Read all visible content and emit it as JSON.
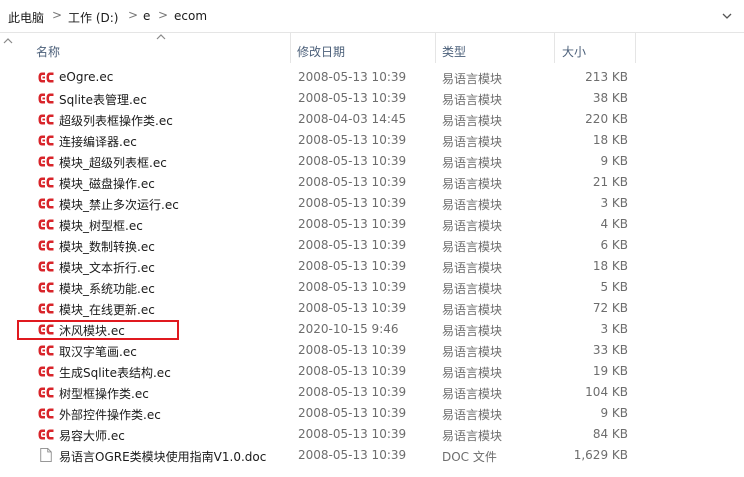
{
  "breadcrumb": {
    "items": [
      "此电脑",
      "工作 (D:)",
      "e",
      "ecom"
    ],
    "separator": ">"
  },
  "columns": {
    "name": "名称",
    "date": "修改日期",
    "type": "类型",
    "size": "大小"
  },
  "files": [
    {
      "name": "eOgre.ec",
      "date": "2008-05-13 10:39",
      "type": "易语言模块",
      "size": "213 KB",
      "icon": "ec-module-icon"
    },
    {
      "name": "Sqlite表管理.ec",
      "date": "2008-05-13 10:39",
      "type": "易语言模块",
      "size": "38 KB",
      "icon": "ec-module-icon"
    },
    {
      "name": "超级列表框操作类.ec",
      "date": "2008-04-03 14:45",
      "type": "易语言模块",
      "size": "220 KB",
      "icon": "ec-module-icon"
    },
    {
      "name": "连接编译器.ec",
      "date": "2008-05-13 10:39",
      "type": "易语言模块",
      "size": "18 KB",
      "icon": "ec-module-icon"
    },
    {
      "name": "模块_超级列表框.ec",
      "date": "2008-05-13 10:39",
      "type": "易语言模块",
      "size": "9 KB",
      "icon": "ec-module-icon"
    },
    {
      "name": "模块_磁盘操作.ec",
      "date": "2008-05-13 10:39",
      "type": "易语言模块",
      "size": "21 KB",
      "icon": "ec-module-icon"
    },
    {
      "name": "模块_禁止多次运行.ec",
      "date": "2008-05-13 10:39",
      "type": "易语言模块",
      "size": "3 KB",
      "icon": "ec-module-icon"
    },
    {
      "name": "模块_树型框.ec",
      "date": "2008-05-13 10:39",
      "type": "易语言模块",
      "size": "4 KB",
      "icon": "ec-module-icon"
    },
    {
      "name": "模块_数制转换.ec",
      "date": "2008-05-13 10:39",
      "type": "易语言模块",
      "size": "6 KB",
      "icon": "ec-module-icon"
    },
    {
      "name": "模块_文本折行.ec",
      "date": "2008-05-13 10:39",
      "type": "易语言模块",
      "size": "18 KB",
      "icon": "ec-module-icon"
    },
    {
      "name": "模块_系统功能.ec",
      "date": "2008-05-13 10:39",
      "type": "易语言模块",
      "size": "5 KB",
      "icon": "ec-module-icon"
    },
    {
      "name": "模块_在线更新.ec",
      "date": "2008-05-13 10:39",
      "type": "易语言模块",
      "size": "72 KB",
      "icon": "ec-module-icon"
    },
    {
      "name": "沐风模块.ec",
      "date": "2020-10-15 9:46",
      "type": "易语言模块",
      "size": "3 KB",
      "icon": "ec-module-icon",
      "highlighted": true
    },
    {
      "name": "取汉字笔画.ec",
      "date": "2008-05-13 10:39",
      "type": "易语言模块",
      "size": "33 KB",
      "icon": "ec-module-icon"
    },
    {
      "name": "生成Sqlite表结构.ec",
      "date": "2008-05-13 10:39",
      "type": "易语言模块",
      "size": "19 KB",
      "icon": "ec-module-icon"
    },
    {
      "name": "树型框操作类.ec",
      "date": "2008-05-13 10:39",
      "type": "易语言模块",
      "size": "104 KB",
      "icon": "ec-module-icon"
    },
    {
      "name": "外部控件操作类.ec",
      "date": "2008-05-13 10:39",
      "type": "易语言模块",
      "size": "9 KB",
      "icon": "ec-module-icon"
    },
    {
      "name": "易容大师.ec",
      "date": "2008-05-13 10:39",
      "type": "易语言模块",
      "size": "84 KB",
      "icon": "ec-module-icon"
    },
    {
      "name": "易语言OGRE类模块使用指南V1.0.doc",
      "date": "2008-05-13 10:39",
      "type": "DOC 文件",
      "size": "1,629 KB",
      "icon": "doc-file-icon"
    }
  ],
  "colors": {
    "highlight_border": "#e0191f",
    "ec_icon": "#d8242a",
    "header_text": "#4c607a"
  }
}
